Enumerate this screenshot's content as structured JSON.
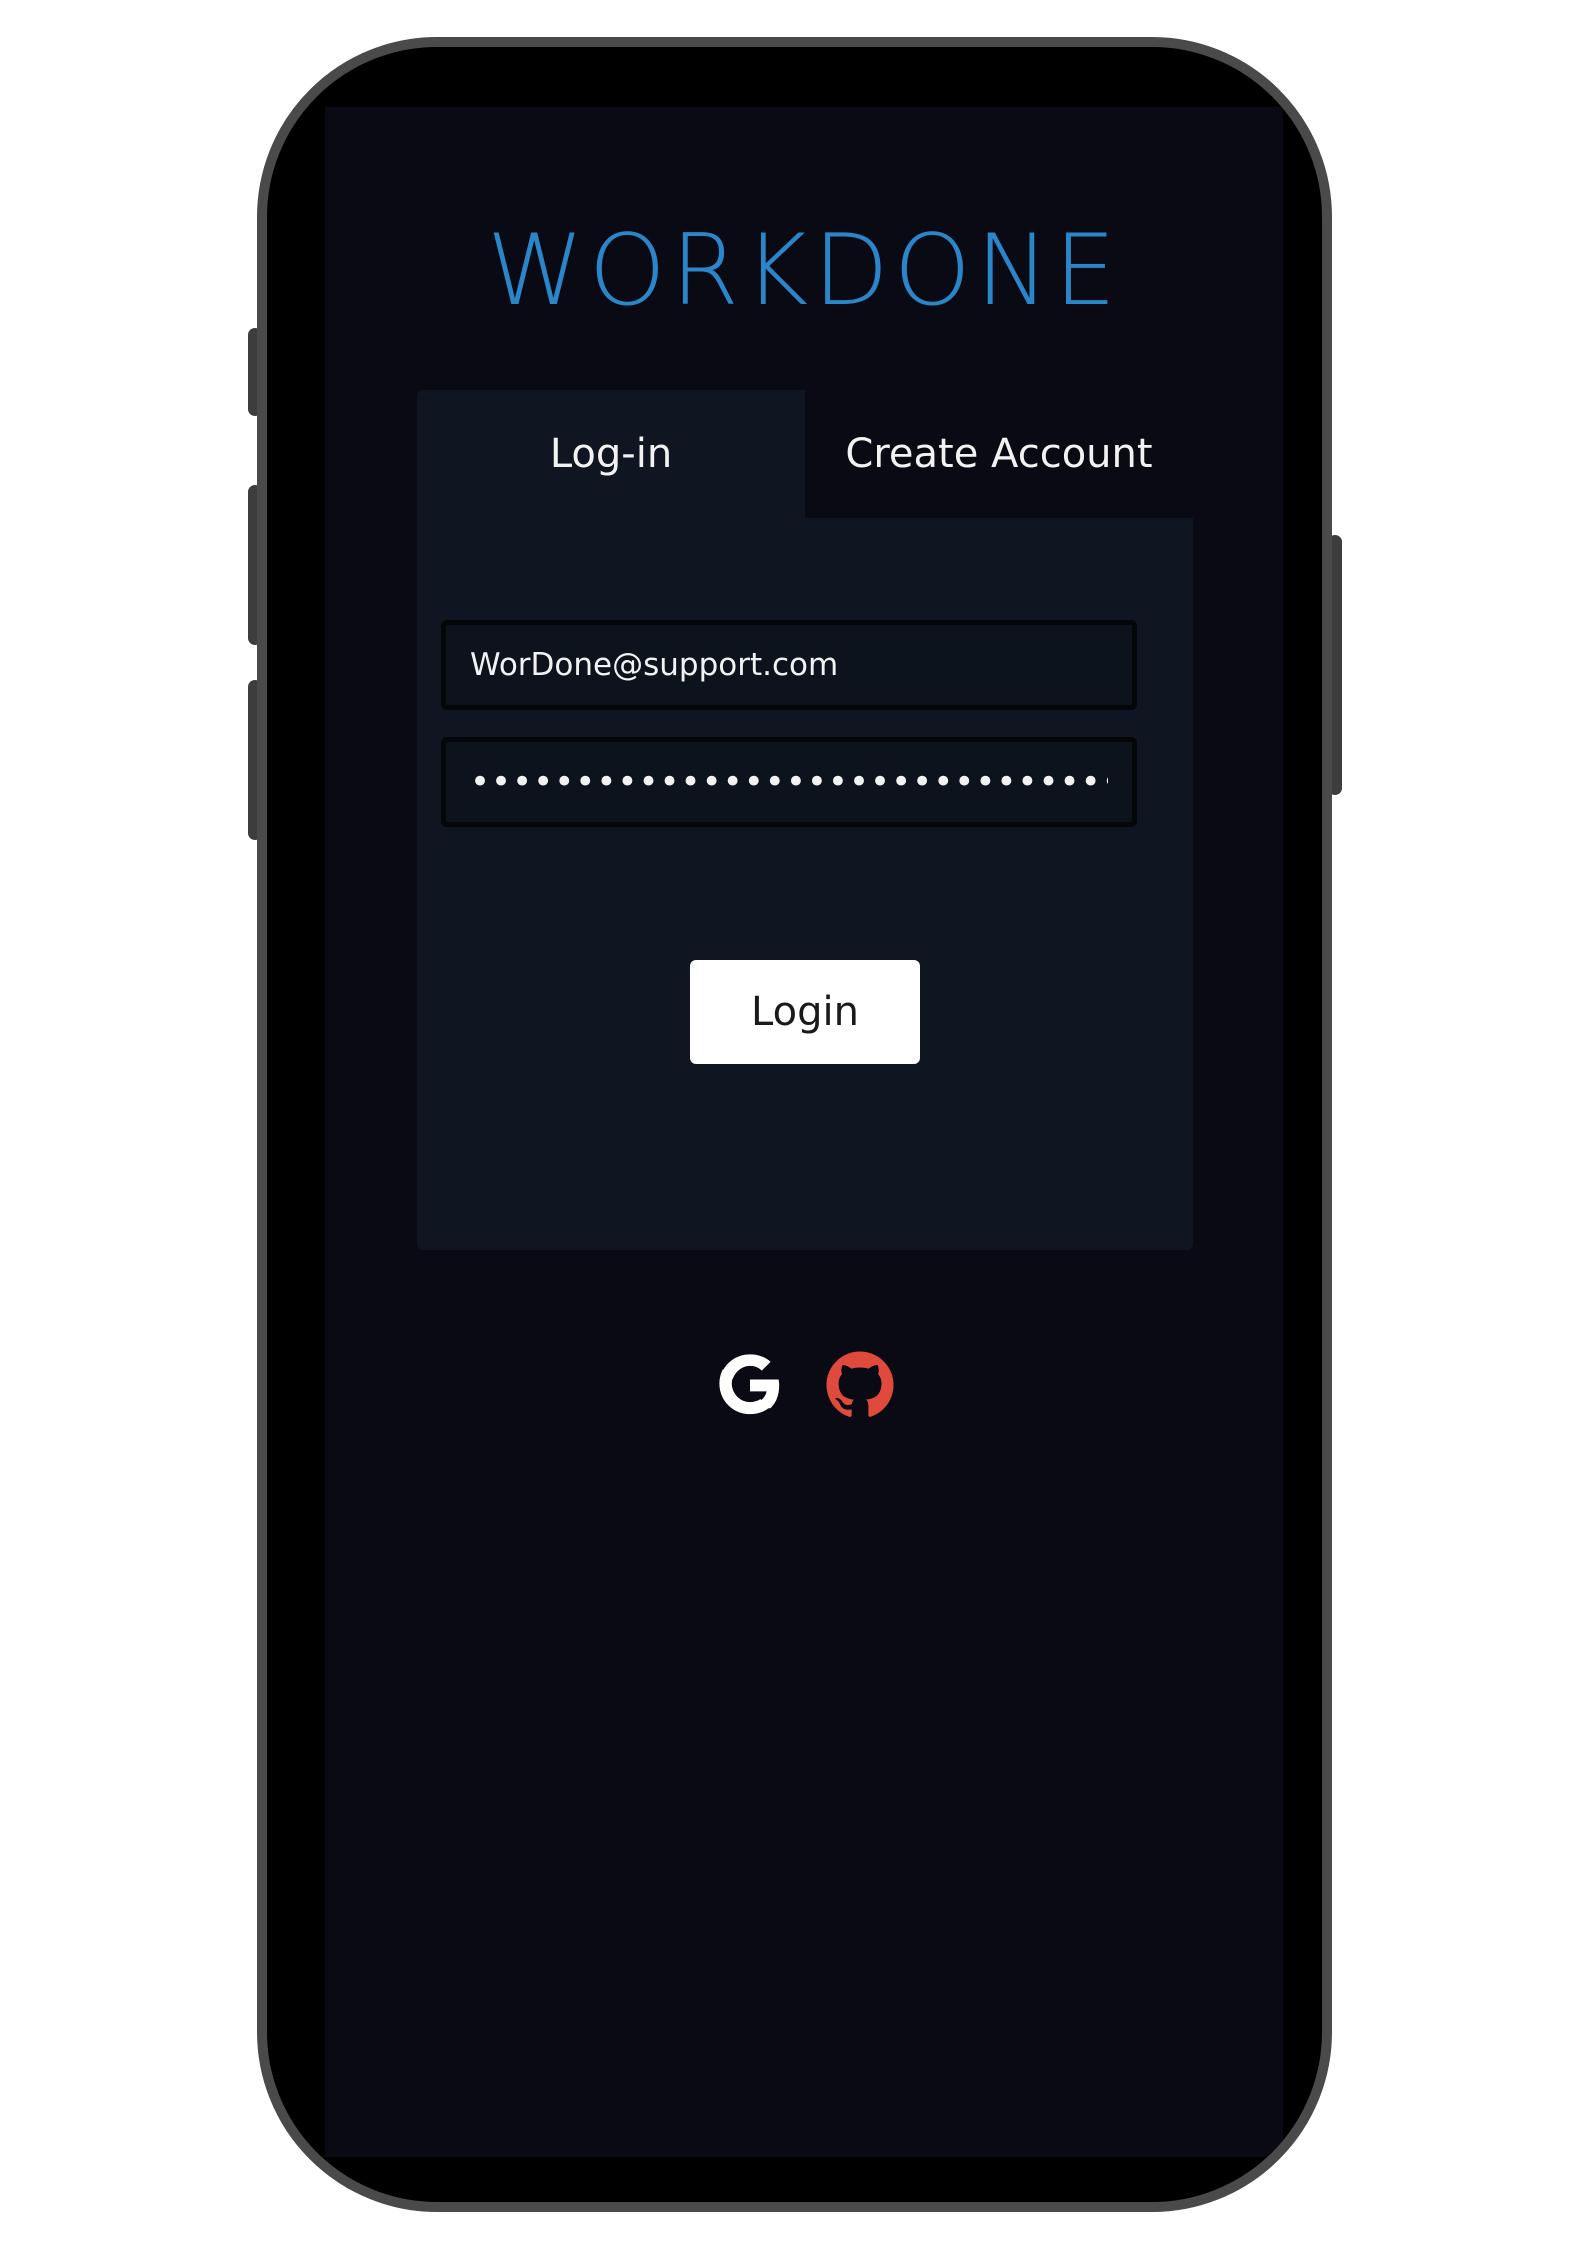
{
  "app": {
    "logo_text": "WORKDONE",
    "accent_color": "#2a86c8"
  },
  "tabs": [
    {
      "label": "Log-in",
      "active": true
    },
    {
      "label": "Create Account",
      "active": false
    }
  ],
  "form": {
    "email_value": "WorDone@support.com",
    "password_value": "••••••••••••••••••••••••••••••••••••••"
  },
  "actions": {
    "login_label": "Login"
  },
  "social": {
    "providers": [
      {
        "icon": "google-icon",
        "color": "#ffffff"
      },
      {
        "icon": "github-icon",
        "color": "#e04a3c"
      }
    ]
  }
}
